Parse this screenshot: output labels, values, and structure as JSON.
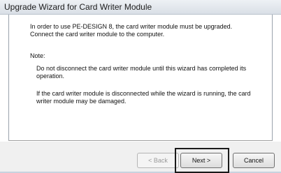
{
  "window": {
    "title": "Upgrade Wizard for Card Writer Module"
  },
  "body": {
    "intro": "In order to use PE-DESIGN 8, the card writer module must be upgraded. Connect the card writer module to the computer.",
    "note_label": "Note:",
    "note_1": "Do not disconnect the card writer module until this wizard has completed its operation.",
    "note_2": "If the card writer module is disconnected while the wizard is running, the card writer module may be damaged."
  },
  "buttons": {
    "back": "< Back",
    "next": "Next >",
    "cancel": "Cancel"
  }
}
